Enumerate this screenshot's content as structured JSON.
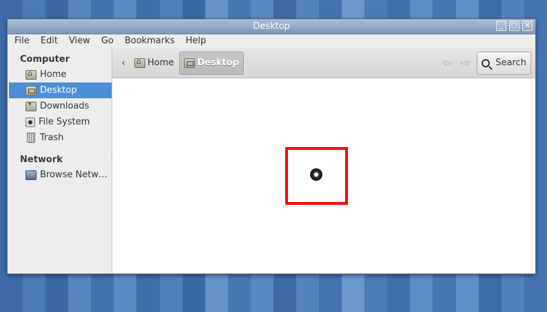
{
  "window": {
    "title": "Desktop"
  },
  "menubar": [
    "File",
    "Edit",
    "View",
    "Go",
    "Bookmarks",
    "Help"
  ],
  "sidebar": {
    "computer_heading": "Computer",
    "computer_items": [
      {
        "label": "Home",
        "icon": "home-folder-icon",
        "selected": false
      },
      {
        "label": "Desktop",
        "icon": "desktop-folder-icon",
        "selected": true
      },
      {
        "label": "Downloads",
        "icon": "downloads-folder-icon",
        "selected": false
      },
      {
        "label": "File System",
        "icon": "drive-icon",
        "selected": false
      },
      {
        "label": "Trash",
        "icon": "trash-icon",
        "selected": false
      }
    ],
    "network_heading": "Network",
    "network_items": [
      {
        "label": "Browse Netw…",
        "icon": "network-icon"
      }
    ]
  },
  "toolbar": {
    "back_glyph": "‹",
    "breadcrumbs": [
      {
        "label": "Home",
        "active": false
      },
      {
        "label": "Desktop",
        "active": true
      }
    ],
    "search_label": "Search"
  },
  "colors": {
    "selection": "#4a90d9",
    "highlight_box": "#ff0000"
  }
}
